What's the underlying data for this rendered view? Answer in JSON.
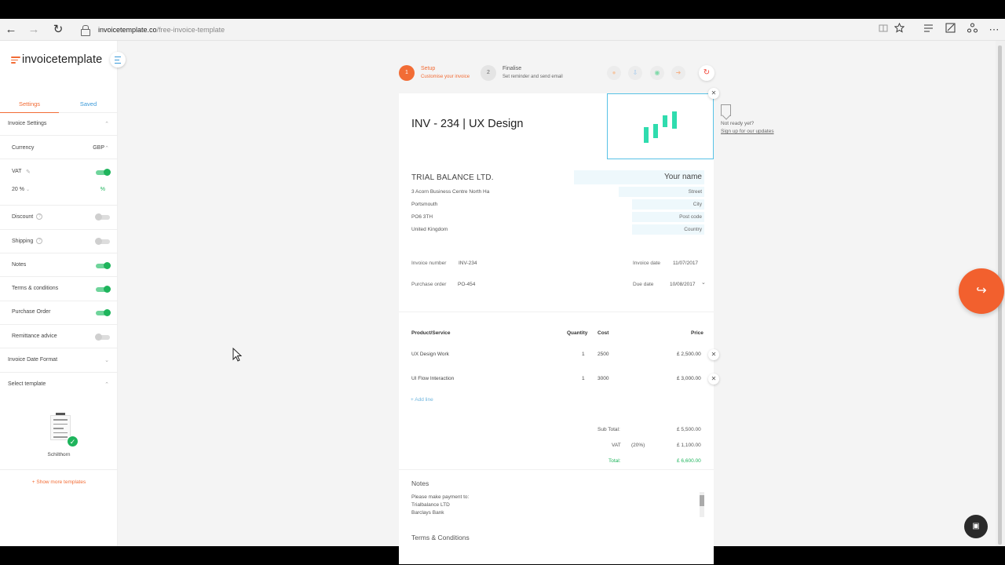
{
  "browser": {
    "url_host": "invoicetemplate.co",
    "url_path": "/free-invoice-template",
    "back_icon": "←",
    "forward_icon": "→",
    "reload_icon": "↻"
  },
  "sidebar": {
    "logo": "invoicetemplate",
    "tabs": {
      "settings": "Settings",
      "saved": "Saved"
    },
    "invoice_settings": "Invoice Settings",
    "currency_label": "Currency",
    "currency_value": "GBP",
    "vat_label": "VAT",
    "vat_rate": "20 %",
    "vat_unit": "%",
    "discount_label": "Discount",
    "shipping_label": "Shipping",
    "notes_label": "Notes",
    "terms_label": "Terms & conditions",
    "po_label": "Purchase Order",
    "remittance_label": "Remittance advice",
    "date_format_label": "Invoice Date Format",
    "select_template_label": "Select template",
    "template_name": "Schilthorn",
    "show_more": "+ Show more templates",
    "help_glyph": "?",
    "toggles": {
      "vat": true,
      "discount": false,
      "shipping": false,
      "notes": true,
      "terms": true,
      "po": true,
      "remittance": false
    }
  },
  "steps": [
    {
      "num": "1",
      "title": "Setup",
      "subtitle": "Customise your invoice"
    },
    {
      "num": "2",
      "title": "Finalise",
      "subtitle": "Set reminder and send email"
    }
  ],
  "invoice": {
    "title": "INV - 234 | UX Design",
    "company": "TRIAL BALANCE LTD.",
    "address": [
      "3 Acorn Business Centre North Ha",
      "Portsmouth",
      "PO6 3TH",
      "United Kingdom"
    ],
    "client_fields": {
      "name": "Your name",
      "street": "Street",
      "city": "City",
      "postcode": "Post code",
      "country": "Country"
    },
    "invoice_number_label": "Invoice number",
    "invoice_number": "INV-234",
    "po_label": "Purchase order",
    "po_value": "PO-454",
    "invoice_date_label": "Invoice date",
    "invoice_date": "11/07/2017",
    "due_date_label": "Due date",
    "due_date": "10/08/2017",
    "table_headers": {
      "product": "Product/Service",
      "quantity": "Quantity",
      "cost": "Cost",
      "price": "Price"
    },
    "lines": [
      {
        "product": "UX Design Work",
        "quantity": "1",
        "cost": "2500",
        "price": "£ 2,500.00"
      },
      {
        "product": "UI Flow Interaction",
        "quantity": "1",
        "cost": "3000",
        "price": "£ 3,000.00"
      }
    ],
    "add_line": "+ Add line",
    "subtotal_label": "Sub Total:",
    "subtotal": "£ 5,500.00",
    "vat_label": "VAT",
    "vat_pct": "(20%)",
    "vat_amount": "£ 1,100.00",
    "total_label": "Total:",
    "total": "£ 6,600.00",
    "notes_title": "Notes",
    "notes_lines": [
      "Please make payment to:",
      "Trialbalance LTD",
      "Barclays Bank"
    ],
    "terms_title": "Terms & Conditions"
  },
  "side_note": {
    "line1": "Not ready yet?",
    "line2": "Sign up for our updates"
  },
  "colors": {
    "accent": "#f26c35",
    "green": "#1eb45c",
    "blue": "#3b9ad9",
    "logo_teal": "#2fdcae"
  }
}
